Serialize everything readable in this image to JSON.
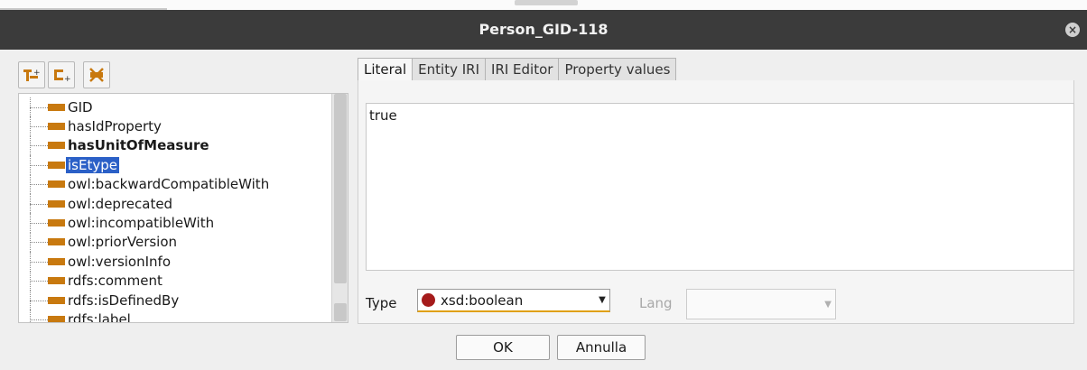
{
  "window": {
    "title": "Person_GID-118"
  },
  "toolbar": {
    "icons": [
      "add-subproperty-icon",
      "add-sibling-property-icon",
      "delete-property-icon"
    ]
  },
  "tree": {
    "items": [
      {
        "label": "GID",
        "bold": false,
        "selected": false
      },
      {
        "label": "hasIdProperty",
        "bold": false,
        "selected": false
      },
      {
        "label": "hasUnitOfMeasure",
        "bold": true,
        "selected": false
      },
      {
        "label": "isEtype",
        "bold": false,
        "selected": true
      },
      {
        "label": "owl:backwardCompatibleWith",
        "bold": false,
        "selected": false
      },
      {
        "label": "owl:deprecated",
        "bold": false,
        "selected": false
      },
      {
        "label": "owl:incompatibleWith",
        "bold": false,
        "selected": false
      },
      {
        "label": "owl:priorVersion",
        "bold": false,
        "selected": false
      },
      {
        "label": "owl:versionInfo",
        "bold": false,
        "selected": false
      },
      {
        "label": "rdfs:comment",
        "bold": false,
        "selected": false
      },
      {
        "label": "rdfs:isDefinedBy",
        "bold": false,
        "selected": false
      },
      {
        "label": "rdfs:label",
        "bold": false,
        "selected": false
      }
    ]
  },
  "tabs": [
    "Literal",
    "Entity IRI",
    "IRI Editor",
    "Property values"
  ],
  "literal": {
    "value": "true"
  },
  "type": {
    "label": "Type",
    "value": "xsd:boolean"
  },
  "lang": {
    "label": "Lang",
    "value": ""
  },
  "buttons": {
    "ok": "OK",
    "cancel": "Annulla"
  },
  "colors": {
    "property_bar": "#c8790f",
    "selection": "#2b60c7",
    "datatype_dot": "#a51b1b",
    "titlebar": "#3b3b3b"
  }
}
